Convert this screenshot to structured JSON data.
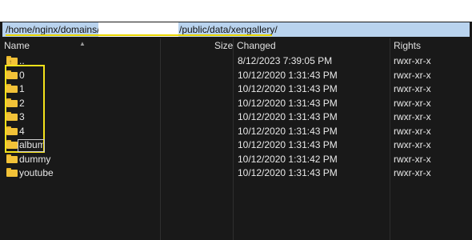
{
  "path": {
    "prefix": "/home/nginx/domains/",
    "suffix": "/public/data/xengallery/"
  },
  "columns": {
    "name": "Name",
    "size": "Size",
    "changed": "Changed",
    "rights": "Rights"
  },
  "rows": [
    {
      "name": "..",
      "changed": "8/12/2023 7:39:05 PM",
      "rights": "rwxr-xr-x",
      "icon": "parent-folder-icon"
    },
    {
      "name": "0",
      "changed": "10/12/2020 1:31:43 PM",
      "rights": "rwxr-xr-x",
      "icon": "folder-icon"
    },
    {
      "name": "1",
      "changed": "10/12/2020 1:31:43 PM",
      "rights": "rwxr-xr-x",
      "icon": "folder-icon"
    },
    {
      "name": "2",
      "changed": "10/12/2020 1:31:43 PM",
      "rights": "rwxr-xr-x",
      "icon": "folder-icon"
    },
    {
      "name": "3",
      "changed": "10/12/2020 1:31:43 PM",
      "rights": "rwxr-xr-x",
      "icon": "folder-icon"
    },
    {
      "name": "4",
      "changed": "10/12/2020 1:31:43 PM",
      "rights": "rwxr-xr-x",
      "icon": "folder-icon"
    },
    {
      "name": "album",
      "changed": "10/12/2020 1:31:43 PM",
      "rights": "rwxr-xr-x",
      "icon": "folder-icon"
    },
    {
      "name": "dummy",
      "changed": "10/12/2020 1:31:42 PM",
      "rights": "rwxr-xr-x",
      "icon": "folder-icon"
    },
    {
      "name": "youtube",
      "changed": "10/12/2020 1:31:43 PM",
      "rights": "rwxr-xr-x",
      "icon": "folder-icon"
    }
  ],
  "colors": {
    "path_bar": "#b9d3ee",
    "panel_background": "#191919",
    "folder": "#f2c238",
    "highlight": "#f5e21a"
  }
}
